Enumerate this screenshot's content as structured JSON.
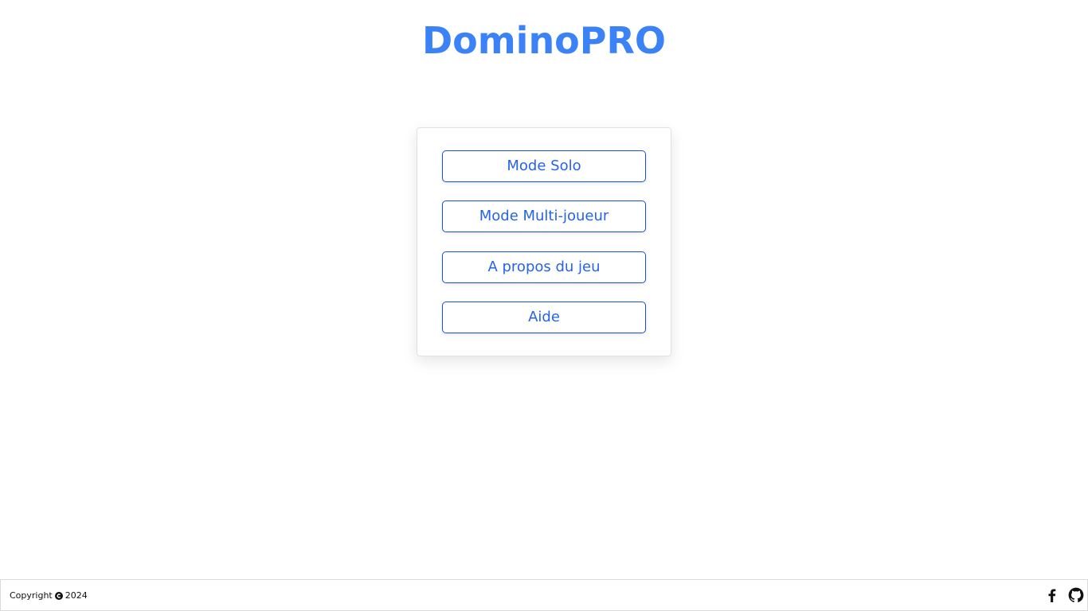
{
  "app": {
    "title": "DominoPRO"
  },
  "menu": {
    "buttons": [
      {
        "label": "Mode Solo"
      },
      {
        "label": "Mode Multi-joueur"
      },
      {
        "label": "A propos du jeu"
      },
      {
        "label": "Aide"
      }
    ]
  },
  "footer": {
    "copyright_prefix": "Copyright",
    "copyright_year": "2024",
    "icons": [
      "copyright-icon",
      "facebook-icon",
      "github-icon"
    ]
  },
  "colors": {
    "title": "#3b82f6",
    "button_text": "#2563eb",
    "button_border": "#1d4ed8",
    "footer_icons": "#111111"
  }
}
